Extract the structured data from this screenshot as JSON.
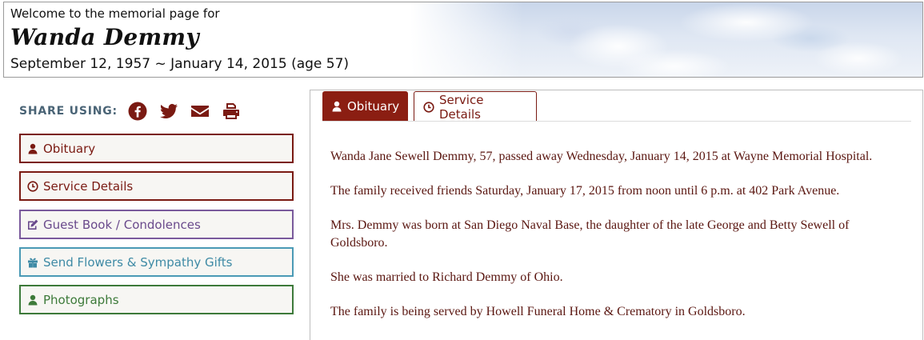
{
  "header": {
    "welcome": "Welcome to the memorial page for",
    "name": "Wanda Demmy",
    "dates": "September 12, 1957 ~ January 14, 2015 (age 57)"
  },
  "share": {
    "label": "SHARE USING:",
    "icons": [
      "facebook-icon",
      "twitter-icon",
      "envelope-icon",
      "print-icon"
    ]
  },
  "sidebar": {
    "items": [
      {
        "label": "Obituary",
        "icon": "user-icon",
        "color": "#7a1a12"
      },
      {
        "label": "Service Details",
        "icon": "clock-icon",
        "color": "#7a1a12"
      },
      {
        "label": "Guest Book / Condolences",
        "icon": "edit-icon",
        "color": "#6a4a8c"
      },
      {
        "label": "Send Flowers & Sympathy Gifts",
        "icon": "gift-icon",
        "color": "#3e8aa5"
      },
      {
        "label": "Photographs",
        "icon": "user-icon",
        "color": "#3d7a3a"
      }
    ]
  },
  "tabs": [
    {
      "label": "Obituary",
      "icon": "user-icon",
      "active": true
    },
    {
      "label": "Service Details",
      "icon": "clock-icon",
      "active": false
    }
  ],
  "obituary": {
    "paragraphs": [
      "Wanda Jane Sewell Demmy, 57, passed away Wednesday, January 14, 2015 at Wayne Memorial Hospital.",
      "The family received friends Saturday, January 17, 2015 from noon until 6 p.m. at 402 Park Avenue.",
      "Mrs. Demmy was born at San Diego Naval Base, the daughter of the late George and Betty Sewell of Goldsboro.",
      "She was married to Richard Demmy of Ohio.",
      "The family is being served by Howell Funeral Home & Crematory in Goldsboro."
    ]
  },
  "colors": {
    "accent": "#8b1e12",
    "text": "#5a1610"
  }
}
